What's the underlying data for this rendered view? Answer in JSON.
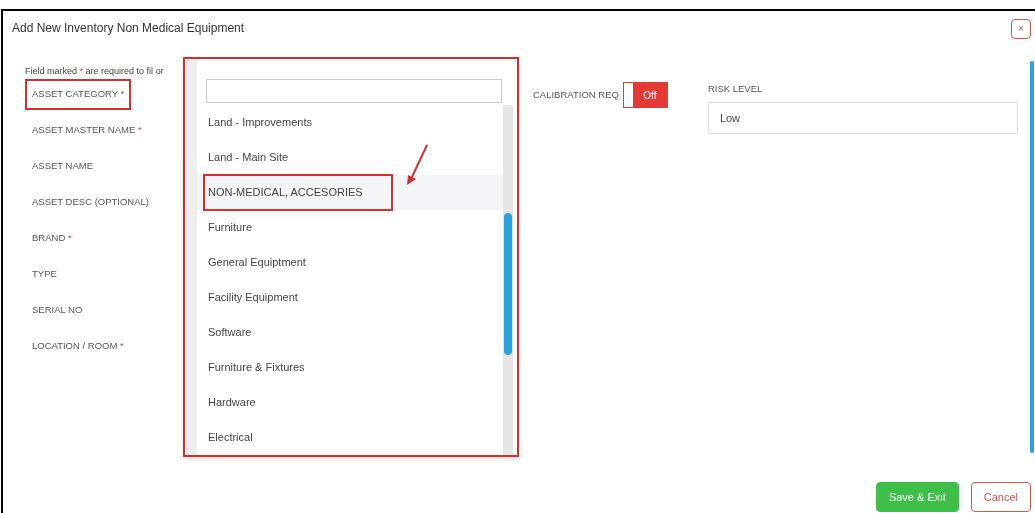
{
  "window": {
    "title": "Add New Inventory Non Medical Equipment",
    "close": "×"
  },
  "note": {
    "before": "Field marked",
    "mark": "*",
    "after": "are required to fil",
    "tail": "or"
  },
  "fields": [
    {
      "label": "ASSET CATEGORY",
      "mark": "*",
      "highlighted": true
    },
    {
      "label": "ASSET MASTER NAME",
      "mark": "*",
      "highlighted": false
    },
    {
      "label": "ASSET NAME",
      "highlighted": false
    },
    {
      "label": "ASSET DESC (OPTIONAL)",
      "highlighted": false
    },
    {
      "label": "BRAND",
      "mark": "*",
      "highlighted": false
    },
    {
      "label": "TYPE",
      "highlighted": false
    },
    {
      "label": "SERIAL NO",
      "highlighted": false
    },
    {
      "label": "LOCATION / ROOM",
      "mark": "*",
      "highlighted": false
    }
  ],
  "calibration": {
    "label": "CALIBRATION REQ",
    "on": false,
    "state_text": "Off"
  },
  "risk_level": {
    "label": "RISK LEVEL",
    "value": "Low"
  },
  "dropdown": {
    "highlighted": true,
    "items": [
      {
        "label": "Land - Improvements",
        "selected": false
      },
      {
        "label": "Land - Main Site",
        "selected": false
      },
      {
        "label": "NON-MEDICAL, ACCESORIES",
        "selected": true
      },
      {
        "label": "Furniture",
        "selected": false
      },
      {
        "label": "General Equiptment",
        "selected": false
      },
      {
        "label": "Facility Equipment",
        "selected": false
      },
      {
        "label": "Software",
        "selected": false
      },
      {
        "label": "Furniture & Fixtures",
        "selected": false
      },
      {
        "label": "Hardware",
        "selected": false
      },
      {
        "label": "Electrical",
        "selected": false
      }
    ]
  },
  "buttons": [
    {
      "label": "Save & Exit",
      "kind": "primary"
    },
    {
      "label": "Cancel",
      "kind": "cancel"
    }
  ]
}
